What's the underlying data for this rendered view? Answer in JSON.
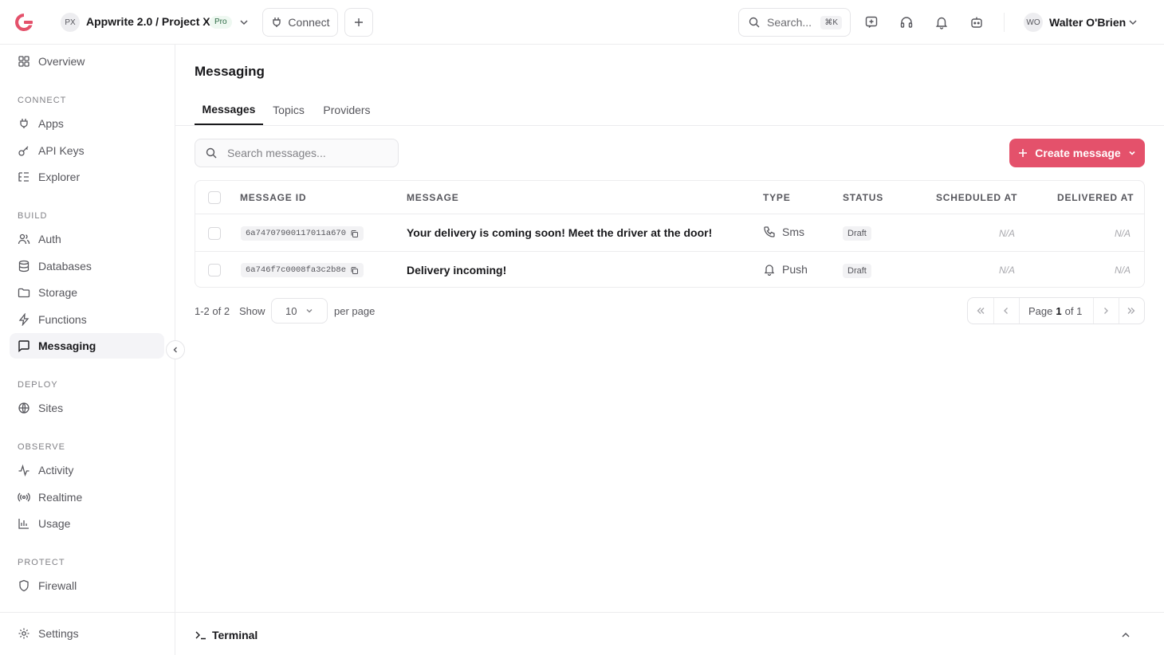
{
  "header": {
    "project_initials": "PX",
    "project_name": "Appwrite 2.0 / Project X",
    "plan_badge": "Pro",
    "connect_label": "Connect",
    "search_placeholder": "Search...",
    "search_shortcut": "⌘K",
    "user_initials": "WO",
    "user_name": "Walter O'Brien",
    "brand_color": "#e4516b"
  },
  "sidebar": {
    "overview": "Overview",
    "sections": {
      "connect": "CONNECT",
      "build": "BUILD",
      "deploy": "DEPLOY",
      "observe": "OBSERVE",
      "protect": "PROTECT"
    },
    "items": {
      "apps": "Apps",
      "api_keys": "API Keys",
      "explorer": "Explorer",
      "auth": "Auth",
      "databases": "Databases",
      "storage": "Storage",
      "functions": "Functions",
      "messaging": "Messaging",
      "sites": "Sites",
      "activity": "Activity",
      "realtime": "Realtime",
      "usage": "Usage",
      "firewall": "Firewall",
      "settings": "Settings"
    },
    "active_item": "Messaging"
  },
  "main": {
    "title": "Messaging",
    "tabs": [
      "Messages",
      "Topics",
      "Providers"
    ],
    "active_tab": "Messages",
    "search_placeholder": "Search messages...",
    "create_button": "Create message",
    "table": {
      "columns": [
        "MESSAGE ID",
        "MESSAGE",
        "TYPE",
        "STATUS",
        "SCHEDULED AT",
        "DELIVERED AT"
      ],
      "rows": [
        {
          "id": "6a74707900117011a670",
          "message": "Your delivery is coming soon! Meet the driver at the door!",
          "type": "Sms",
          "type_icon": "phone-icon",
          "status": "Draft",
          "scheduled_at": "N/A",
          "delivered_at": "N/A"
        },
        {
          "id": "6a746f7c0008fa3c2b8e",
          "message": "Delivery incoming!",
          "type": "Push",
          "type_icon": "bell-icon",
          "status": "Draft",
          "scheduled_at": "N/A",
          "delivered_at": "N/A"
        }
      ]
    },
    "pagination": {
      "range": "1-2 of 2",
      "show_label": "Show",
      "per_page_value": "10",
      "per_page_label": "per page",
      "page_label": "Page",
      "current_page": "1",
      "of_label": "of 1"
    }
  },
  "terminal": {
    "label": "Terminal"
  }
}
